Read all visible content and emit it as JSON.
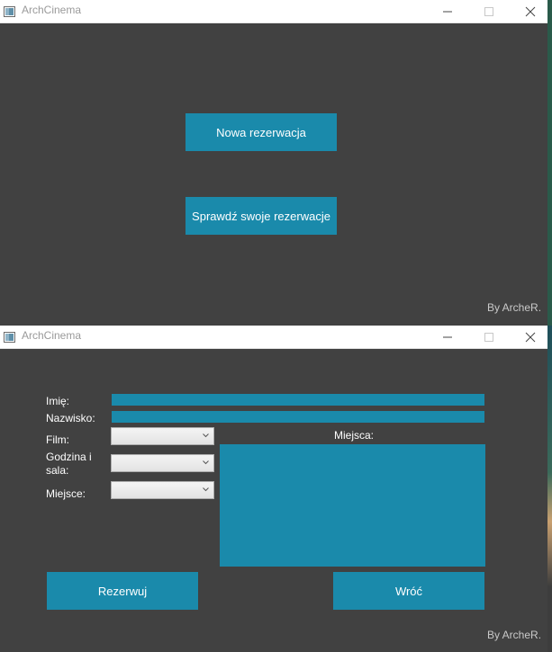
{
  "windows": [
    {
      "title": "ArchCinema",
      "buttons": {
        "new_reservation": "Nowa rezerwacja",
        "check_reservations": "Sprawdź swoje rezerwacje"
      },
      "credit": "By ArcheR."
    },
    {
      "title": "ArchCinema",
      "form": {
        "first_name_label": "Imię:",
        "last_name_label": "Nazwisko:",
        "film_label": "Film:",
        "time_hall_label": "Godzina i sala:",
        "seat_label": "Miejsce:",
        "seats_label": "Miejsca:",
        "first_name_value": "",
        "last_name_value": "",
        "film_value": "",
        "time_hall_value": "",
        "seat_value": ""
      },
      "buttons": {
        "reserve": "Rezerwuj",
        "back": "Wróć"
      },
      "credit": "By ArcheR."
    }
  ],
  "colors": {
    "accent": "#1a8aab",
    "background": "#414141",
    "titlebar": "#ffffff"
  },
  "icons": {
    "app": "app-icon",
    "minimize": "minimize-icon",
    "maximize": "maximize-icon",
    "close": "close-icon",
    "dropdown": "chevron-down-icon"
  }
}
